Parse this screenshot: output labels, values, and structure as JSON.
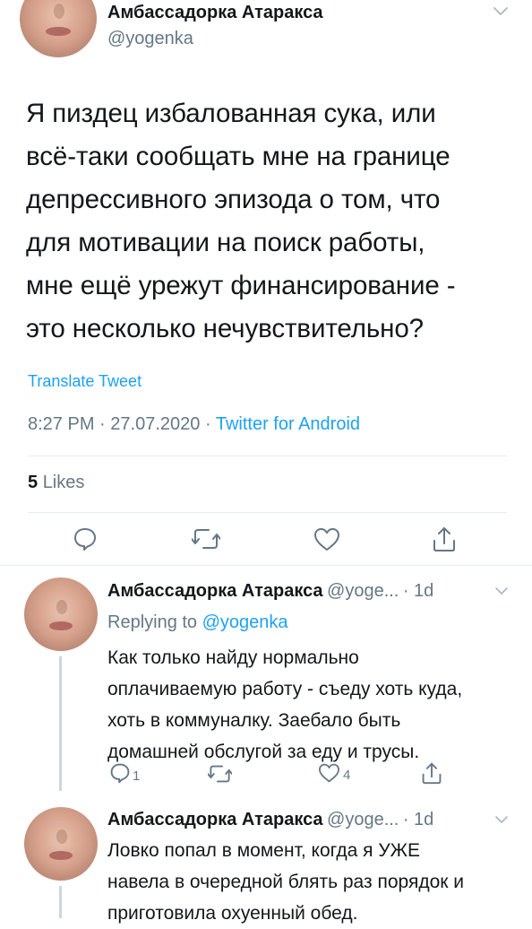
{
  "main_tweet": {
    "author_name": "Амбассадорка Атаракса",
    "handle": "@yogenka",
    "text_lines": [
      "Я пиздец избалованная сука, или",
      "всё-таки сообщать мне на границе",
      "депрессивного эпизода о том, что",
      "для мотивации на поиск работы,",
      "мне ещё урежут финансирование -",
      "это несколько нечувствительно?"
    ],
    "translate_label": "Translate Tweet",
    "time": "8:27 PM",
    "date": "27.07.2020",
    "separator": "·",
    "source": "Twitter for Android",
    "likes_count": "5",
    "likes_label": "Likes"
  },
  "replies": [
    {
      "author_name": "Амбассадорка Атаракса",
      "handle": "@yoge...",
      "age": "· 1d",
      "replying_prefix": "Replying to",
      "replying_handle": "@yogenka",
      "text_lines": [
        "Как только найду нормально",
        "оплачиваемую работу - съеду хоть куда,",
        "хоть в коммуналку. Заебало быть",
        "домашней обслугой за еду и трусы."
      ],
      "reply_count": "1",
      "like_count": "4"
    },
    {
      "author_name": "Амбассадорка Атаракса",
      "handle": "@yoge...",
      "age": "· 1d",
      "text_lines": [
        "Ловко попал в момент, когда я УЖЕ",
        "навела в очередной блять раз порядок и",
        "приготовила охуенный обед."
      ]
    }
  ],
  "icons": {
    "caret": "chevron-down-icon",
    "reply": "reply-icon",
    "retweet": "retweet-icon",
    "like": "heart-icon",
    "share": "share-icon"
  },
  "colors": {
    "text": "#14171a",
    "secondary": "#657786",
    "link": "#1da1f2",
    "divider": "#e6ecf0",
    "icon": "#657786"
  }
}
